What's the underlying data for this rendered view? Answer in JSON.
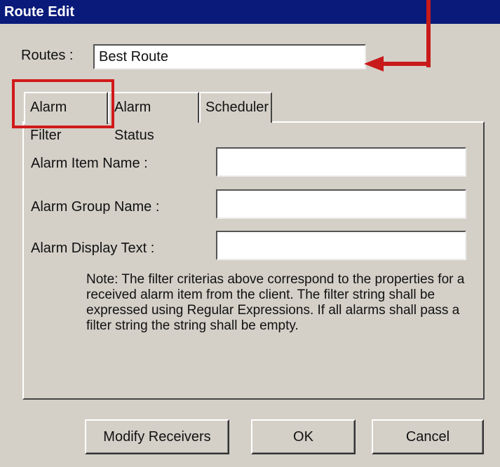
{
  "window": {
    "title": "Route Edit"
  },
  "routes": {
    "label": "Routes :",
    "value": "Best Route"
  },
  "tabs": [
    {
      "label": "Alarm Filter",
      "active": true
    },
    {
      "label": "Alarm Status",
      "active": false
    },
    {
      "label": "Scheduler",
      "active": false
    }
  ],
  "filter": {
    "fields": [
      {
        "label": "Alarm Item Name :",
        "value": ""
      },
      {
        "label": "Alarm Group Name :",
        "value": ""
      },
      {
        "label": "Alarm Display Text :",
        "value": ""
      }
    ],
    "note": "Note: The filter criterias above correspond to the properties for a received alarm item from the client. The filter string shall be expressed using Regular Expressions. If all alarms shall pass a filter string the string shall be empty."
  },
  "buttons": {
    "modify_receivers": "Modify Receivers",
    "ok": "OK",
    "cancel": "Cancel"
  },
  "colors": {
    "titlebar": "#0a1a7a",
    "dialog_bg": "#d4d0c8",
    "annotation": "#c81a1a"
  }
}
